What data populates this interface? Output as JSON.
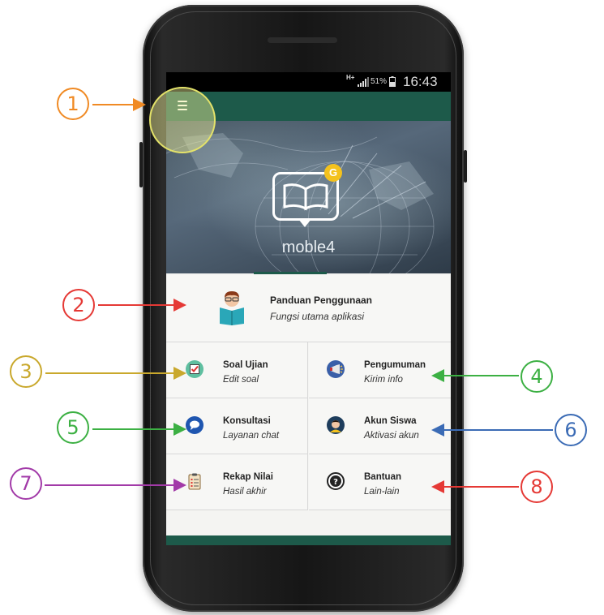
{
  "status_bar": {
    "network": "H+",
    "battery_percent": "51%",
    "time": "16:43"
  },
  "app": {
    "brand": "moble4",
    "badge": "G"
  },
  "guide": {
    "title": "Panduan Penggunaan",
    "subtitle": "Fungsi utama aplikasi",
    "icon": "reading-person-icon"
  },
  "menu": [
    {
      "title": "Soal Ujian",
      "subtitle": "Edit soal",
      "icon": "checkbox-icon"
    },
    {
      "title": "Pengumuman",
      "subtitle": "Kirim info",
      "icon": "megaphone-icon"
    },
    {
      "title": "Konsultasi",
      "subtitle": "Layanan chat",
      "icon": "chat-bubble-icon"
    },
    {
      "title": "Akun Siswa",
      "subtitle": "Aktivasi akun",
      "icon": "student-avatar-icon"
    },
    {
      "title": "Rekap Nilai",
      "subtitle": "Hasil akhir",
      "icon": "clipboard-icon"
    },
    {
      "title": "Bantuan",
      "subtitle": "Lain-lain",
      "icon": "help-icon"
    }
  ],
  "callouts": [
    {
      "label": "1",
      "color": "#f08a24"
    },
    {
      "label": "2",
      "color": "#e53935"
    },
    {
      "label": "3",
      "color": "#c9a82c"
    },
    {
      "label": "4",
      "color": "#3cb043"
    },
    {
      "label": "5",
      "color": "#3cb043"
    },
    {
      "label": "6",
      "color": "#3b6bb5"
    },
    {
      "label": "7",
      "color": "#a23aa8"
    },
    {
      "label": "8",
      "color": "#e53935"
    }
  ],
  "colors": {
    "app_bar": "#1d5a4a",
    "badge": "#f4c21d"
  }
}
